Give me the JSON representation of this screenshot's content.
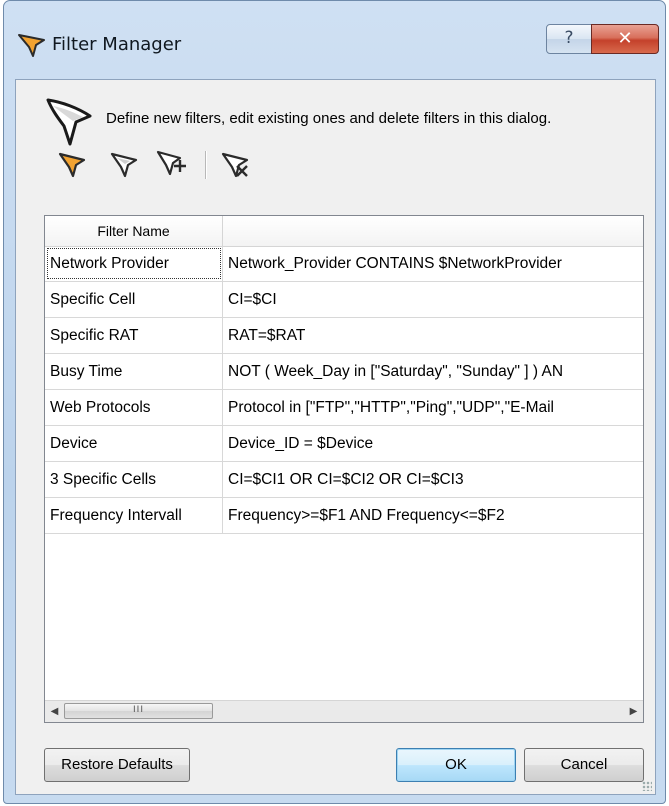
{
  "window": {
    "title": "Filter Manager",
    "help_glyph": "?",
    "close_glyph": "✕"
  },
  "header": {
    "description": "Define new filters, edit existing ones and delete filters in this dialog."
  },
  "toolbar": {
    "buttons": [
      {
        "name": "new-filter",
        "icon": "funnel-new-icon"
      },
      {
        "name": "edit-filter",
        "icon": "funnel-edit-icon"
      },
      {
        "name": "copy-filter",
        "icon": "funnel-copy-icon"
      },
      {
        "name": "delete-filter",
        "icon": "funnel-delete-icon"
      }
    ]
  },
  "table": {
    "columns": [
      "Filter Name",
      ""
    ],
    "rows": [
      {
        "name": "Network Provider",
        "expression": "Network_Provider CONTAINS $NetworkProvider"
      },
      {
        "name": "Specific Cell",
        "expression": "CI=$CI"
      },
      {
        "name": "Specific RAT",
        "expression": "RAT=$RAT"
      },
      {
        "name": "Busy Time",
        "expression": "NOT ( Week_Day in [\"Saturday\", \"Sunday\" ] ) AN"
      },
      {
        "name": "Web Protocols",
        "expression": "Protocol in [\"FTP\",\"HTTP\",\"Ping\",\"UDP\",\"E-Mail"
      },
      {
        "name": "Device",
        "expression": "Device_ID = $Device"
      },
      {
        "name": "3 Specific Cells",
        "expression": "CI=$CI1 OR CI=$CI2 OR CI=$CI3"
      },
      {
        "name": "Frequency Intervall",
        "expression": "Frequency>=$F1 AND Frequency<=$F2"
      }
    ],
    "scrollbar": {
      "left_arrow": "◀",
      "right_arrow": "▶",
      "thumb_grip": "III"
    }
  },
  "buttons": {
    "restore": "Restore Defaults",
    "ok": "OK",
    "cancel": "Cancel"
  },
  "colors": {
    "title_bar": "#c7dbf0",
    "close_button": "#c4412b",
    "funnel_orange": "#f2a230",
    "funnel_dark": "#222222",
    "default_button": "#bee6fd"
  }
}
